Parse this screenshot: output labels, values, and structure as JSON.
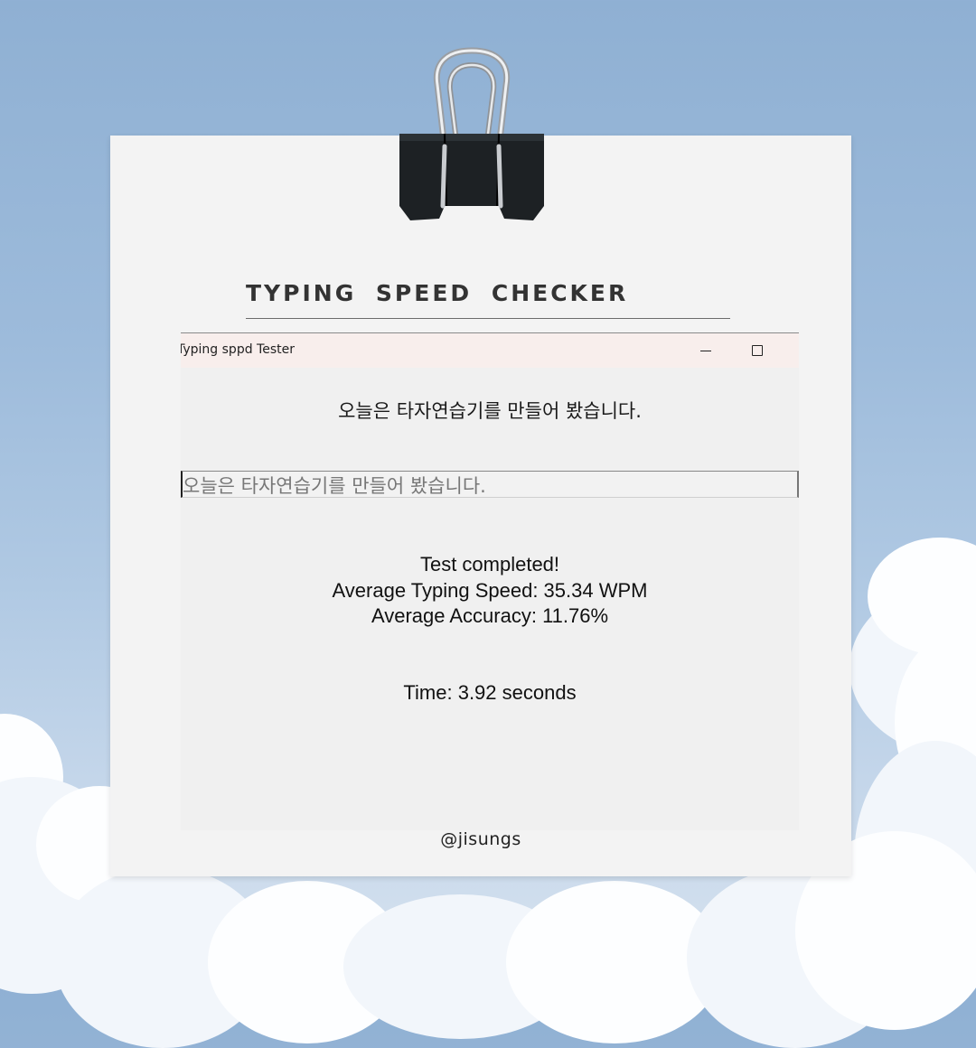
{
  "poster": {
    "heading": "TYPING SPEED CHECKER",
    "credit": "@jisungs"
  },
  "window": {
    "title": "Typing sppd Tester",
    "titlebar_color": "#f8eeec",
    "controls": [
      "minimize-icon",
      "maximize-icon"
    ]
  },
  "test": {
    "prompt_sentence": "오늘은 타자연습기를 만들어 봤습니다.",
    "typed_text": "오늘은 타자연습기를 만들어 봤습니다.",
    "status": "Test completed!",
    "speed_line": "Average Typing Speed: 35.34 WPM",
    "accuracy_line": "Average Accuracy: 11.76%",
    "time_line": "Time: 3.92 seconds"
  }
}
